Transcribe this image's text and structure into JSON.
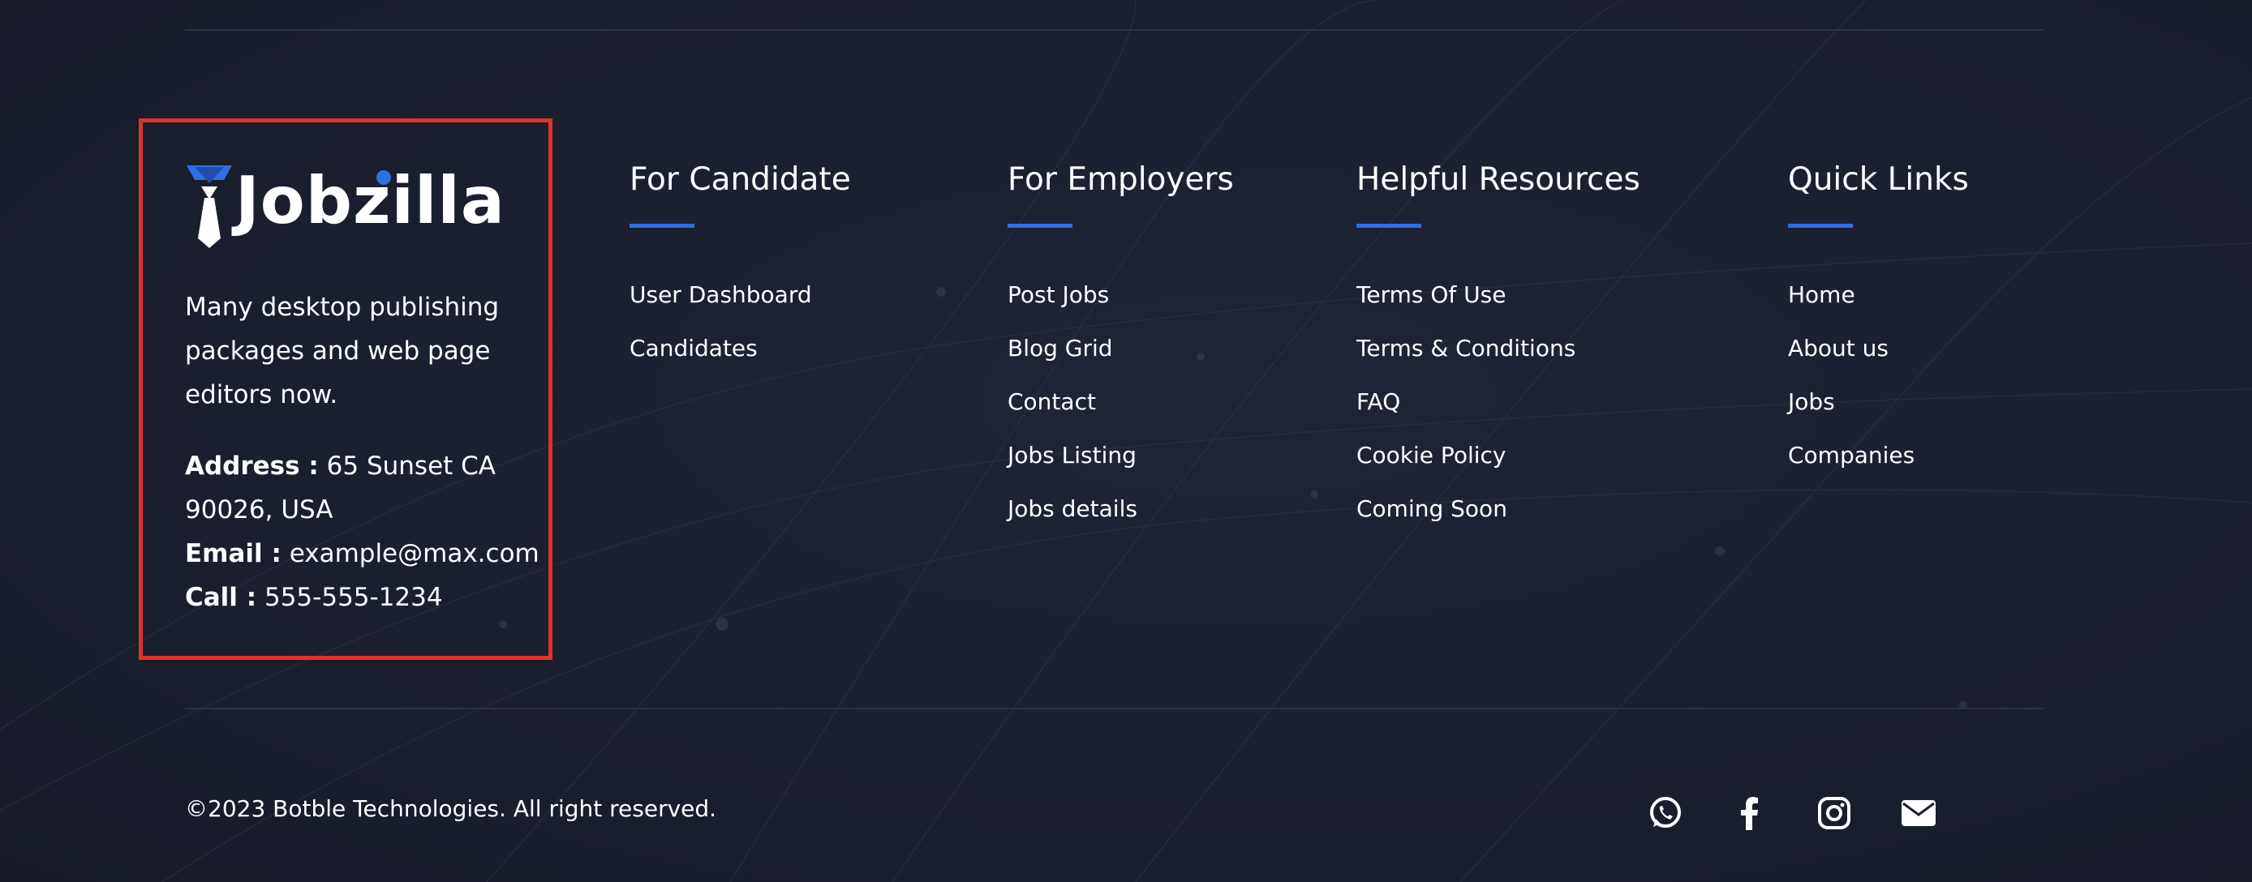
{
  "brand": {
    "logo_text": "Jobzilla",
    "description": "Many desktop publishing packages and web page editors now.",
    "address_label": "Address :",
    "address_value": "65 Sunset CA 90026, USA",
    "email_label": "Email :",
    "email_value": "example@max.com",
    "call_label": "Call :",
    "call_value": "555-555-1234"
  },
  "columns": [
    {
      "title": "For Candidate",
      "links": [
        "User Dashboard",
        "Candidates"
      ]
    },
    {
      "title": "For Employers",
      "links": [
        "Post Jobs",
        "Blog Grid",
        "Contact",
        "Jobs Listing",
        "Jobs details"
      ]
    },
    {
      "title": "Helpful Resources",
      "links": [
        "Terms Of Use",
        "Terms & Conditions",
        "FAQ",
        "Cookie Policy",
        "Coming Soon"
      ]
    },
    {
      "title": "Quick Links",
      "links": [
        "Home",
        "About us",
        "Jobs",
        "Companies"
      ]
    }
  ],
  "copyright": "©2023 Botble Technologies. All right reserved.",
  "socials": [
    "whatsapp-icon",
    "facebook-icon",
    "instagram-icon",
    "email-icon"
  ],
  "colors": {
    "background": "#1a1f2e",
    "accent": "#2f6fe0",
    "highlight_border": "#e0322a",
    "text": "#ffffff"
  }
}
